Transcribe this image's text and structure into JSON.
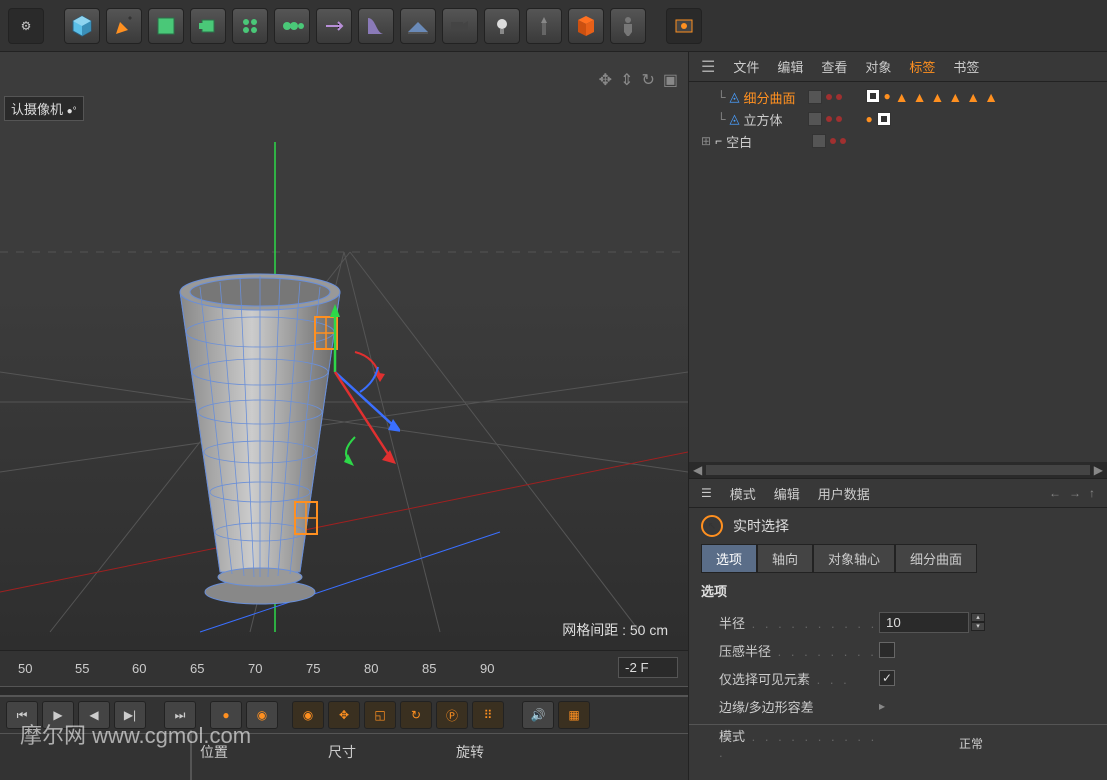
{
  "toolbar": {
    "buttons": [
      "settings",
      "cube",
      "pen",
      "subdiv",
      "extrude",
      "array",
      "clone",
      "axis",
      "deform",
      "floor",
      "camera",
      "light",
      "target",
      "material",
      "figure",
      "render"
    ]
  },
  "viewport": {
    "camera_label": "认摄像机",
    "grid_info": "网格间距 : 50 cm"
  },
  "timeline": {
    "ticks": [
      "50",
      "55",
      "60",
      "65",
      "70",
      "75",
      "80",
      "85",
      "90"
    ],
    "frame_value": "-2 F",
    "labels": {
      "position": "位置",
      "size": "尺寸",
      "rotation": "旋转"
    }
  },
  "watermark": "摩尔网 www.cgmol.com",
  "object_manager": {
    "menu": {
      "file": "文件",
      "edit": "编辑",
      "view": "查看",
      "object": "对象",
      "tags": "标签",
      "bookmarks": "书签"
    },
    "tree": [
      {
        "name": "细分曲面",
        "highlighted": true,
        "indent": 1
      },
      {
        "name": "立方体",
        "highlighted": false,
        "indent": 1
      },
      {
        "name": "空白",
        "highlighted": false,
        "indent": 0,
        "expandable": true
      }
    ]
  },
  "attribute_manager": {
    "menu": {
      "mode": "模式",
      "edit": "编辑",
      "userdata": "用户数据"
    },
    "title": "实时选择",
    "tabs": {
      "options": "选项",
      "axis": "轴向",
      "object_axis": "对象轴心",
      "subdiv": "细分曲面"
    },
    "section_title": "选项",
    "fields": {
      "radius": {
        "label": "半径",
        "value": "10"
      },
      "pressure_radius": {
        "label": "压感半径"
      },
      "visible_only": {
        "label": "仅选择可见元素",
        "checked": true
      },
      "tolerance": {
        "label": "边缘/多边形容差"
      },
      "mode": {
        "label": "模式",
        "value": "正常"
      }
    }
  }
}
